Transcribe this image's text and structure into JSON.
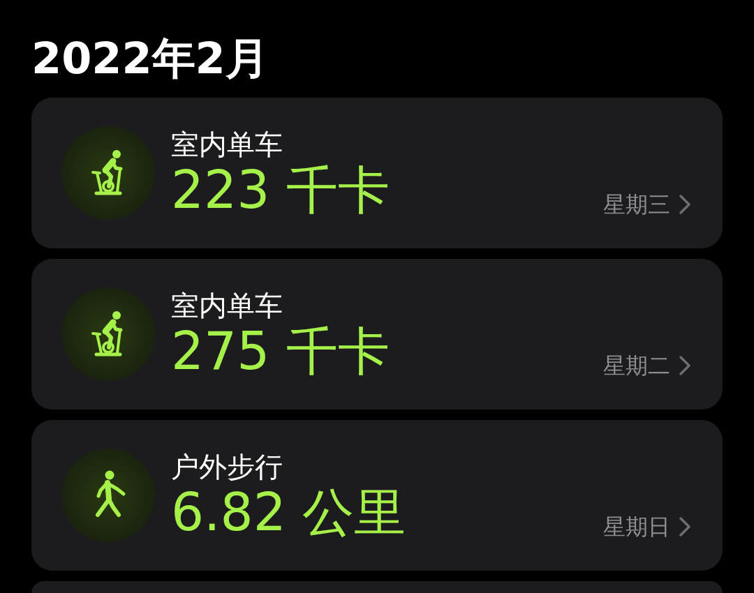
{
  "title": "2022年2月",
  "workouts": [
    {
      "kind": "cycling",
      "name": "室内单车",
      "amount": "223 千卡",
      "day": "星期三"
    },
    {
      "kind": "cycling",
      "name": "室内单车",
      "amount": "275 千卡",
      "day": "星期二"
    },
    {
      "kind": "walking",
      "name": "户外步行",
      "amount": "6.82 公里",
      "day": "星期日"
    }
  ],
  "more_below": true
}
